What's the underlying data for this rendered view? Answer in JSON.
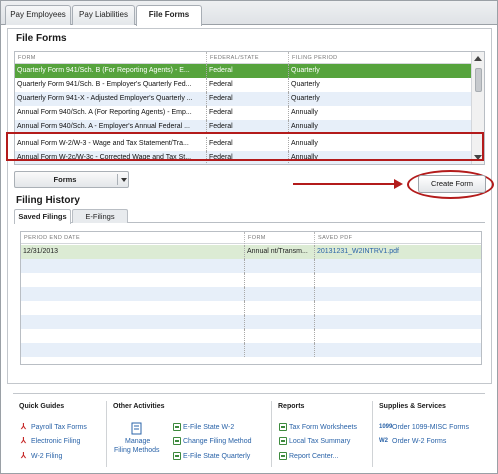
{
  "top_tabs": [
    {
      "label": "Pay Employees"
    },
    {
      "label": "Pay Liabilities"
    },
    {
      "label": "File Forms"
    }
  ],
  "file_forms": {
    "title": "File Forms",
    "columns": [
      "FORM",
      "FEDERAL/STATE",
      "FILING PERIOD"
    ],
    "rows": [
      {
        "form": "Quarterly Form 941/Sch. B (For Reporting Agents) - E...",
        "fed_state": "Federal",
        "period": "Quarterly"
      },
      {
        "form": "Quarterly Form 941/Sch. B - Employer's Quarterly Fed...",
        "fed_state": "Federal",
        "period": "Quarterly"
      },
      {
        "form": "Quarterly Form 941-X - Adjusted Employer's Quarterly ...",
        "fed_state": "Federal",
        "period": "Quarterly"
      },
      {
        "form": "Annual Form 940/Sch. A (For Reporting Agents) - Emp...",
        "fed_state": "Federal",
        "period": "Annually"
      },
      {
        "form": "Annual Form 940/Sch. A - Employer's Annual Federal ...",
        "fed_state": "Federal",
        "period": "Annually"
      },
      {
        "form": "Annual Form W-2/W-3 - Wage and Tax Statement/Tra...",
        "fed_state": "Federal",
        "period": "Annually"
      },
      {
        "form": "Annual Form W-2c/W-3c - Corrected Wage and Tax St...",
        "fed_state": "Federal",
        "period": "Annually"
      }
    ],
    "forms_dropdown": "Forms",
    "create_button": "Create Form"
  },
  "filing_history": {
    "title": "Filing History",
    "tabs": [
      "Saved Filings",
      "E-Filings"
    ],
    "columns": [
      "PERIOD END DATE",
      "FORM",
      "SAVED PDF"
    ],
    "rows": [
      {
        "period_end": "12/31/2013",
        "form": "Annual nt/Transm...",
        "pdf": "20131231_W2INTRV1.pdf"
      }
    ]
  },
  "quick_guides": {
    "title": "Quick Guides",
    "links": [
      "Payroll Tax Forms",
      "Electronic Filing",
      "W-2 Filing"
    ]
  },
  "other_activities": {
    "title": "Other Activities",
    "manage_line1": "Manage",
    "manage_line2": "Filing Methods",
    "links": [
      "E-File State W-2",
      "Change Filing Method",
      "E-File State Quarterly"
    ]
  },
  "reports": {
    "title": "Reports",
    "links": [
      "Tax Form Worksheets",
      "Local Tax Summary",
      "Report Center..."
    ]
  },
  "supplies": {
    "title": "Supplies & Services",
    "links": [
      {
        "badge": "1099",
        "label": "Order 1099-MISC Forms"
      },
      {
        "badge": "W2",
        "label": "Order W-2 Forms"
      }
    ]
  },
  "colors": {
    "selected_row": "#56a33d",
    "annotation_red": "#b31b1b",
    "link_blue": "#2a63a8"
  }
}
